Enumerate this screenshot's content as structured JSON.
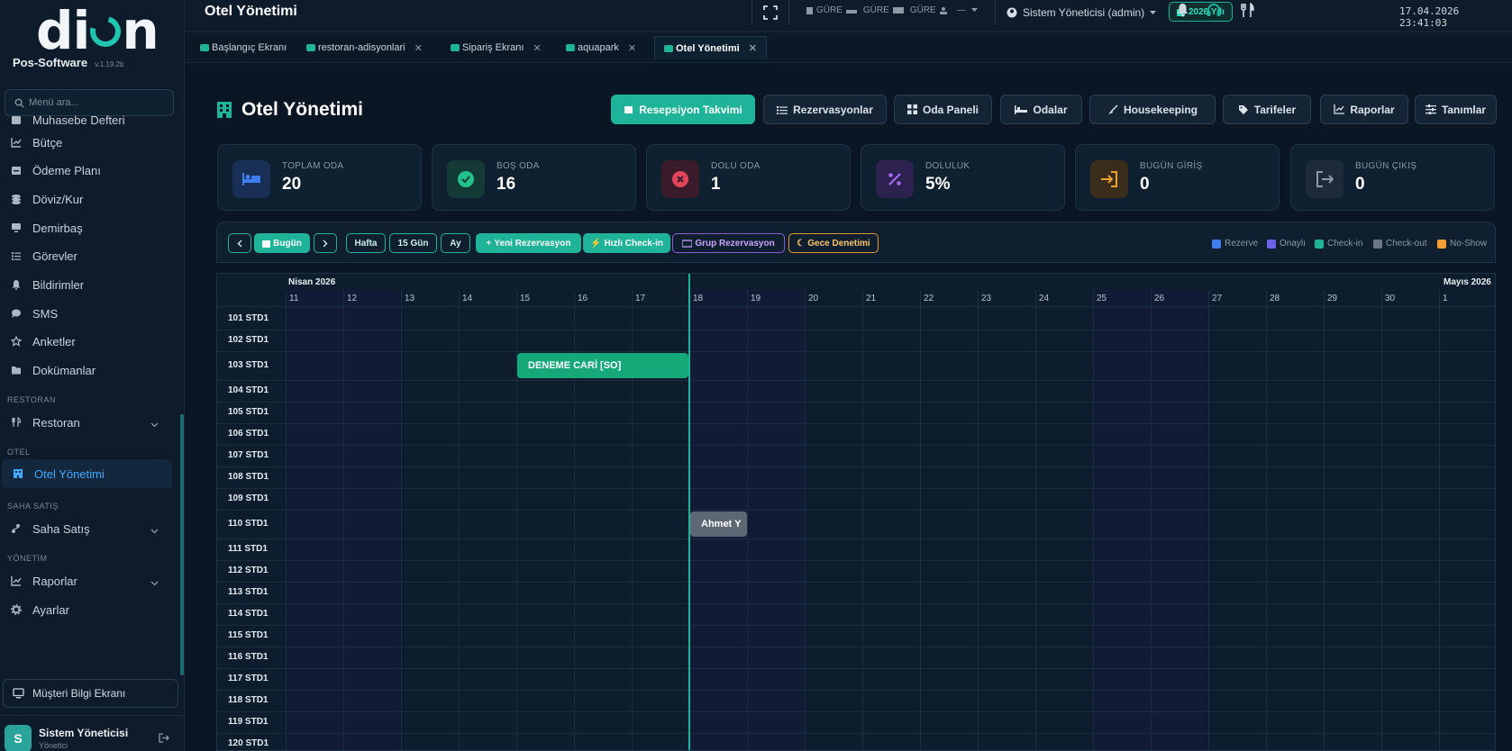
{
  "sidebar": {
    "logo": "dion",
    "brand": "Pos-Software",
    "version": "v.1.19.2b",
    "search_placeholder": "Menü ara...",
    "items": [
      {
        "label": "Muhasebe Defteri",
        "icon": "ledger-icon"
      },
      {
        "label": "Bütçe",
        "icon": "chart-icon"
      },
      {
        "label": "Ödeme Planı",
        "icon": "calendar-icon"
      },
      {
        "label": "Döviz/Kur",
        "icon": "coins-icon"
      },
      {
        "label": "Demirbaş",
        "icon": "monitor-icon"
      },
      {
        "label": "Görevler",
        "icon": "list-icon"
      },
      {
        "label": "Bildirimler",
        "icon": "bell-icon"
      },
      {
        "label": "SMS",
        "icon": "chat-icon"
      },
      {
        "label": "Anketler",
        "icon": "star-icon"
      },
      {
        "label": "Dokümanlar",
        "icon": "folder-icon"
      }
    ],
    "sections": {
      "restoran": "RESTORAN",
      "otel": "OTEL",
      "saha": "SAHA SATIŞ",
      "yonetim": "YÖNETİM"
    },
    "restoran_item": "Restoran",
    "otel_item": "Otel Yönetimi",
    "saha_item": "Saha Satış",
    "raporlar_item": "Raporlar",
    "ayarlar_item": "Ayarlar",
    "customer_screen": "Müşteri Bilgi Ekranı",
    "user": {
      "initial": "S",
      "name": "Sistem Yöneticisi",
      "role": "Yönetici"
    }
  },
  "header": {
    "title": "Otel Yönetimi",
    "stat1": "GÜRE",
    "stat2": "GÜRE",
    "stat3": "GÜRE",
    "stat4": "—",
    "user": "Sistem Yöneticisi (admin)",
    "year": "2026 Yılı",
    "datetime": "17.04.2026 23:41:03"
  },
  "tabs": [
    {
      "label": "Başlangıç Ekranı"
    },
    {
      "label": "restoran-adisyonlari"
    },
    {
      "label": "Sipariş Ekranı"
    },
    {
      "label": "aquapark"
    },
    {
      "label": "Otel Yönetimi"
    }
  ],
  "main": {
    "title": "Otel Yönetimi",
    "nav": [
      "Resepsiyon Takvimi",
      "Rezervasyonlar",
      "Oda Paneli",
      "Odalar",
      "Housekeeping",
      "Tarifeler",
      "Raporlar",
      "Tanımlar"
    ],
    "cards": [
      {
        "label": "TOPLAM ODA",
        "value": "20",
        "icon": "bed-icon",
        "color": "#3f7cf0"
      },
      {
        "label": "BOŞ ODA",
        "value": "16",
        "icon": "check-icon",
        "color": "#22c08a"
      },
      {
        "label": "DOLU ODA",
        "value": "1",
        "icon": "x-icon",
        "color": "#e0455a"
      },
      {
        "label": "DOLULUK",
        "value": "5%",
        "icon": "percent-icon",
        "color": "#a46cf0"
      },
      {
        "label": "BUGÜN GİRİŞ",
        "value": "0",
        "icon": "login-icon",
        "color": "#f0a030"
      },
      {
        "label": "BUGÜN ÇIKIŞ",
        "value": "0",
        "icon": "logout-icon",
        "color": "#8d9aa6"
      }
    ]
  },
  "toolbar": {
    "today": "Bugün",
    "week": "Hafta",
    "days15": "15 Gün",
    "month": "Ay",
    "new_res": "Yeni Rezervasyon",
    "quick_checkin": "Hızlı Check-in",
    "group_res": "Grup Rezervasyon",
    "night_audit": "Gece Denetimi",
    "legend": [
      {
        "label": "Rezerve",
        "color": "#3f7cf0"
      },
      {
        "label": "Onaylı",
        "color": "#6c63e8"
      },
      {
        "label": "Check-in",
        "color": "#1fb39a"
      },
      {
        "label": "Check-out",
        "color": "#6b7785"
      },
      {
        "label": "No-Show",
        "color": "#f0a030"
      }
    ]
  },
  "calendar": {
    "month1": "Nisan 2026",
    "month2": "Mayıs 2026",
    "days": [
      "11",
      "12",
      "13",
      "14",
      "15",
      "16",
      "17",
      "18",
      "19",
      "20",
      "21",
      "22",
      "23",
      "24",
      "25",
      "26",
      "27",
      "28",
      "29",
      "30",
      "1"
    ],
    "rooms": [
      "101 STD1",
      "102 STD1",
      "103 STD1",
      "104 STD1",
      "105 STD1",
      "106 STD1",
      "107 STD1",
      "108 STD1",
      "109 STD1",
      "110 STD1",
      "111 STD1",
      "112 STD1",
      "113 STD1",
      "114 STD1",
      "115 STD1",
      "116 STD1",
      "117 STD1",
      "118 STD1",
      "119 STD1",
      "120 STD1"
    ],
    "reservations": [
      {
        "label": "DENEME CARİ [SO]",
        "room": "103 STD1",
        "start": "15",
        "end": "17",
        "status": "Check-in",
        "color": "#17a87a"
      },
      {
        "label": "Ahmet Y",
        "room": "110 STD1",
        "start": "18",
        "end": "18",
        "status": "Check-out",
        "color": "#5d6875"
      }
    ]
  }
}
